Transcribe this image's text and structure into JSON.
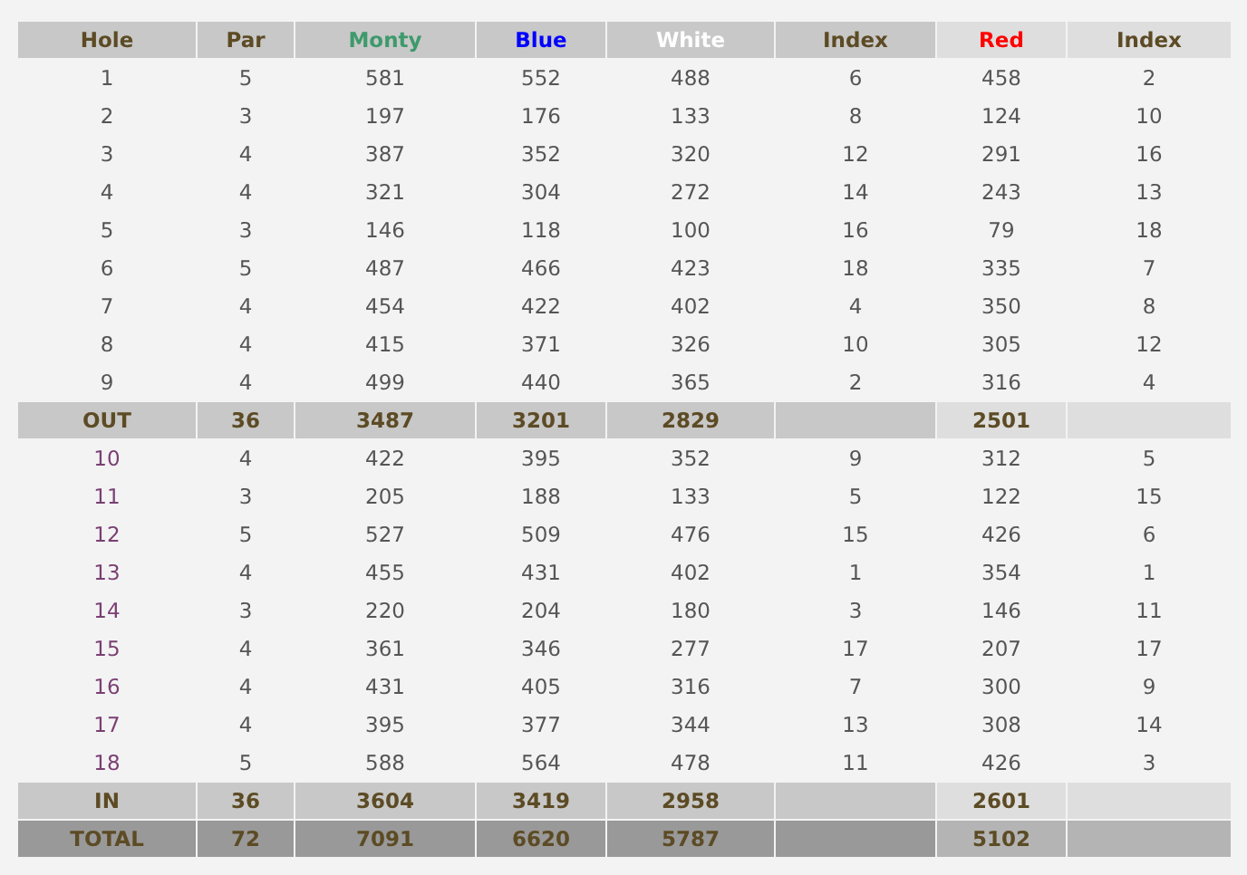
{
  "columns": [
    {
      "label": "Hole",
      "color": "#5c4b24",
      "kind": "main"
    },
    {
      "label": "Par",
      "color": "#5c4b24",
      "kind": "main"
    },
    {
      "label": "Monty",
      "color": "#3d9a6c",
      "kind": "main"
    },
    {
      "label": "Blue",
      "color": "#0000ff",
      "kind": "main"
    },
    {
      "label": "White",
      "color": "#ffffff",
      "kind": "main"
    },
    {
      "label": "Index",
      "color": "#5c4b24",
      "kind": "main"
    },
    {
      "label": "Red",
      "color": "#ff0000",
      "kind": "ladies"
    },
    {
      "label": "Index",
      "color": "#5c4b24",
      "kind": "ladies"
    }
  ],
  "rows": [
    {
      "kind": "hole",
      "color": "#555555",
      "cells": [
        "1",
        "5",
        "581",
        "552",
        "488",
        "6",
        "458",
        "2"
      ]
    },
    {
      "kind": "hole",
      "color": "#555555",
      "cells": [
        "2",
        "3",
        "197",
        "176",
        "133",
        "8",
        "124",
        "10"
      ]
    },
    {
      "kind": "hole",
      "color": "#555555",
      "cells": [
        "3",
        "4",
        "387",
        "352",
        "320",
        "12",
        "291",
        "16"
      ]
    },
    {
      "kind": "hole",
      "color": "#555555",
      "cells": [
        "4",
        "4",
        "321",
        "304",
        "272",
        "14",
        "243",
        "13"
      ]
    },
    {
      "kind": "hole",
      "color": "#555555",
      "cells": [
        "5",
        "3",
        "146",
        "118",
        "100",
        "16",
        "79",
        "18"
      ]
    },
    {
      "kind": "hole",
      "color": "#555555",
      "cells": [
        "6",
        "5",
        "487",
        "466",
        "423",
        "18",
        "335",
        "7"
      ]
    },
    {
      "kind": "hole",
      "color": "#555555",
      "cells": [
        "7",
        "4",
        "454",
        "422",
        "402",
        "4",
        "350",
        "8"
      ]
    },
    {
      "kind": "hole",
      "color": "#555555",
      "cells": [
        "8",
        "4",
        "415",
        "371",
        "326",
        "10",
        "305",
        "12"
      ]
    },
    {
      "kind": "hole",
      "color": "#555555",
      "cells": [
        "9",
        "4",
        "499",
        "440",
        "365",
        "2",
        "316",
        "4"
      ]
    },
    {
      "kind": "subtotal",
      "cells": [
        "OUT",
        "36",
        "3487",
        "3201",
        "2829",
        null,
        "2501",
        null
      ]
    },
    {
      "kind": "hole",
      "color": "#7a3f73",
      "cells": [
        "10",
        "4",
        "422",
        "395",
        "352",
        "9",
        "312",
        "5"
      ]
    },
    {
      "kind": "hole",
      "color": "#7a3f73",
      "cells": [
        "11",
        "3",
        "205",
        "188",
        "133",
        "5",
        "122",
        "15"
      ]
    },
    {
      "kind": "hole",
      "color": "#7a3f73",
      "cells": [
        "12",
        "5",
        "527",
        "509",
        "476",
        "15",
        "426",
        "6"
      ]
    },
    {
      "kind": "hole",
      "color": "#7a3f73",
      "cells": [
        "13",
        "4",
        "455",
        "431",
        "402",
        "1",
        "354",
        "1"
      ]
    },
    {
      "kind": "hole",
      "color": "#7a3f73",
      "cells": [
        "14",
        "3",
        "220",
        "204",
        "180",
        "3",
        "146",
        "11"
      ]
    },
    {
      "kind": "hole",
      "color": "#7a3f73",
      "cells": [
        "15",
        "4",
        "361",
        "346",
        "277",
        "17",
        "207",
        "17"
      ]
    },
    {
      "kind": "hole",
      "color": "#7a3f73",
      "cells": [
        "16",
        "4",
        "431",
        "405",
        "316",
        "7",
        "300",
        "9"
      ]
    },
    {
      "kind": "hole",
      "color": "#7a3f73",
      "cells": [
        "17",
        "4",
        "395",
        "377",
        "344",
        "13",
        "308",
        "14"
      ]
    },
    {
      "kind": "hole",
      "color": "#7a3f73",
      "cells": [
        "18",
        "5",
        "588",
        "564",
        "478",
        "11",
        "426",
        "3"
      ]
    },
    {
      "kind": "subtotal",
      "cells": [
        "IN",
        "36",
        "3604",
        "3419",
        "2958",
        null,
        "2601",
        null
      ]
    },
    {
      "kind": "total",
      "cells": [
        "TOTAL",
        "72",
        "7091",
        "6620",
        "5787",
        null,
        "5102",
        null
      ]
    }
  ]
}
